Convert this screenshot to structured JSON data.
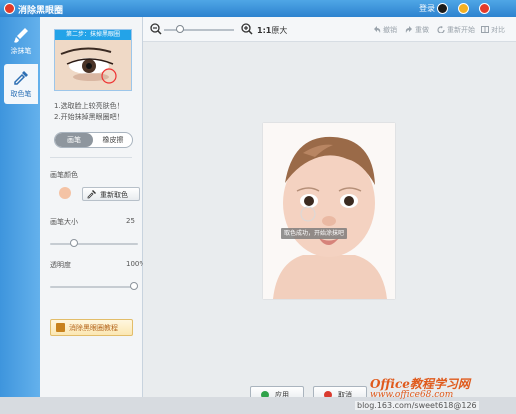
{
  "window": {
    "title": "消除黑眼圈",
    "login_label": "登录"
  },
  "tabs": [
    {
      "label": "涂抹笔",
      "icon": "brush-icon",
      "active": false
    },
    {
      "label": "取色笔",
      "icon": "eyedropper-icon",
      "active": true
    }
  ],
  "panel": {
    "step_title": "第二步：抹掉黑眼圈",
    "instructions": [
      "1.选取脸上较亮肤色！",
      "2.开始抹掉黑眼圈吧！"
    ],
    "mode_options": [
      "画笔",
      "橡皮擦"
    ],
    "mode_selected": "画笔",
    "brush_color_label": "画笔颜色",
    "brush_color": "#f4c3a5",
    "repick_label": "重新取色",
    "brush_size_label": "画笔大小",
    "brush_size_value": "25",
    "brush_size_fraction": 0.25,
    "opacity_label": "透明度",
    "opacity_value": "100%",
    "opacity_fraction": 1.0,
    "tutorial_label": "消除黑眼圈教程"
  },
  "toolbar": {
    "zoom_ratio": "1:1",
    "zoom_original": "原大",
    "zoom_fraction": 0.2,
    "undo_label": "撤销",
    "redo_label": "重做",
    "restart_label": "重新开始",
    "compare_label": "对比"
  },
  "canvas": {
    "tooltip": "取色成功，开始涂抹吧"
  },
  "actions": {
    "apply_label": "应用",
    "cancel_label": "取消"
  },
  "watermark": {
    "site": "Office教程学习网",
    "url": "www.office68.com",
    "blog": "blog.163.com/sweet618@126"
  },
  "colors": {
    "accent": "#2d83cf",
    "step_header": "#23a3e8",
    "tutorial_text": "#b5661f",
    "watermark": "#e05a1c"
  }
}
